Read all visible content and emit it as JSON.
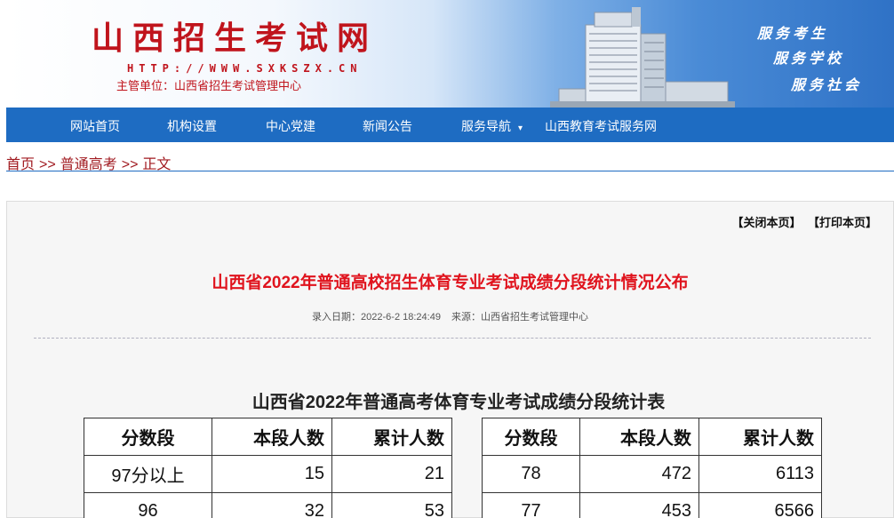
{
  "header": {
    "title": "山西招生考试网",
    "url": "HTTP://WWW.SXKSZX.CN",
    "org": "主管单位：山西省招生考试管理中心",
    "slogans": [
      "服务考生",
      "服务学校",
      "服务社会"
    ]
  },
  "nav": {
    "items": [
      "网站首页",
      "机构设置",
      "中心党建",
      "新闻公告",
      "服务导航",
      "山西教育考试服务网"
    ],
    "caret": "▾"
  },
  "breadcrumb": {
    "home": "首页",
    "section": "普通高考",
    "current": "正文",
    "separator": ">>"
  },
  "tools": {
    "close": "【关闭本页】",
    "print": "【打印本页】"
  },
  "article": {
    "title": "山西省2022年普通高校招生体育专业考试成绩分段统计情况公布",
    "date_label": "录入日期：2022-6-2 18:24:49",
    "source_label": "来源：山西省招生考试管理中心",
    "table_title": "山西省2022年普通高考体育专业考试成绩分段统计表"
  },
  "score_table": {
    "headers": [
      "分数段",
      "本段人数",
      "累计人数"
    ],
    "left_rows": [
      [
        "97分以上",
        "15",
        "21"
      ],
      [
        "96",
        "32",
        "53"
      ]
    ],
    "right_rows": [
      [
        "78",
        "472",
        "6113"
      ],
      [
        "77",
        "453",
        "6566"
      ]
    ]
  },
  "colors": {
    "brand_red": "#c0141c",
    "nav_blue": "#1e6cc2",
    "title_red": "#e0141e"
  }
}
